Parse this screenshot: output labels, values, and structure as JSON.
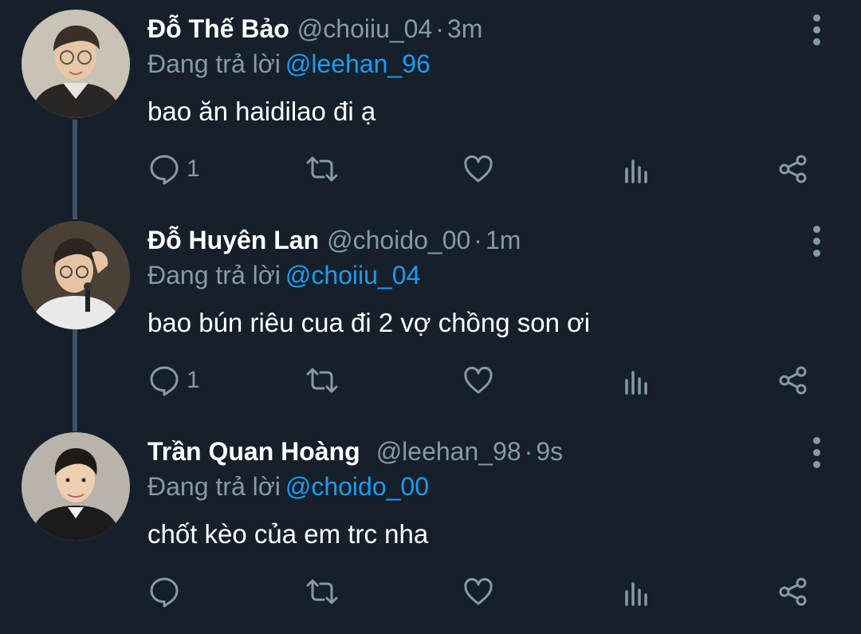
{
  "theme": {
    "background": "#15202b",
    "text": "#ffffff",
    "muted": "#8899a6",
    "accent": "#1d9bf0",
    "thread_line": "#3d5466"
  },
  "tweets": [
    {
      "name": "Đỗ Thế Bảo",
      "handle": "@choiiu_04",
      "separator": "·",
      "time": "3m",
      "reply_prefix": "Đang trả lời",
      "reply_to": "@leehan_96",
      "text": "bao ăn haidilao đi ạ",
      "reply_count": "1",
      "icons": [
        "reply-icon",
        "retweet-icon",
        "like-icon",
        "analytics-icon",
        "share-icon",
        "more-icon"
      ]
    },
    {
      "name": "Đỗ Huyên Lan",
      "handle": "@choido_00",
      "separator": "·",
      "time": "1m",
      "reply_prefix": "Đang trả lời",
      "reply_to": "@choiiu_04",
      "text": "bao bún riêu cua đi 2 vợ chồng son ơi",
      "reply_count": "1",
      "icons": [
        "reply-icon",
        "retweet-icon",
        "like-icon",
        "analytics-icon",
        "share-icon",
        "more-icon"
      ]
    },
    {
      "name": "Trần Quan Hoàng",
      "handle": "@leehan_98",
      "separator": "·",
      "time": "9s",
      "reply_prefix": "Đang trả lời",
      "reply_to": "@choido_00",
      "text": "chốt kèo của em trc nha",
      "reply_count": "",
      "icons": [
        "reply-icon",
        "retweet-icon",
        "like-icon",
        "analytics-icon",
        "share-icon",
        "more-icon"
      ]
    }
  ]
}
